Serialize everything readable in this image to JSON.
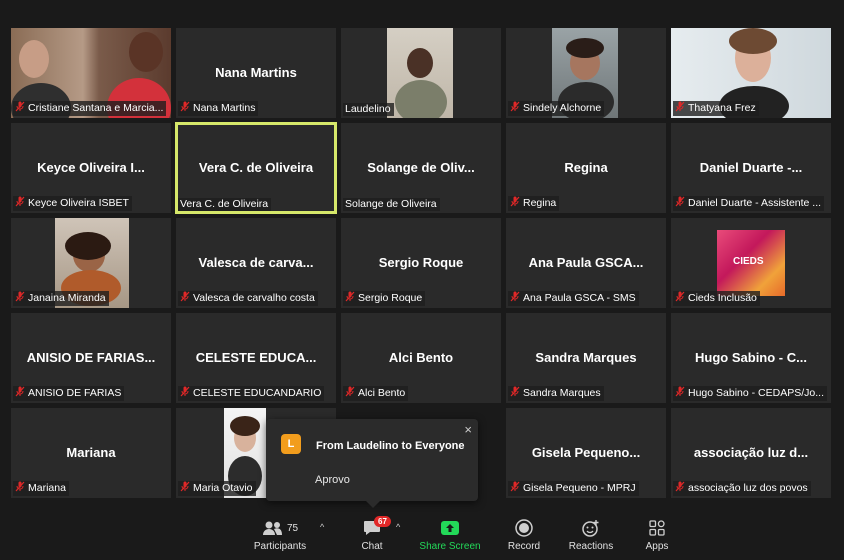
{
  "tiles": [
    {
      "name": "Cristiane Santana e Marcia...",
      "big": "",
      "video": "two",
      "muted": true
    },
    {
      "name": "Nana Martins",
      "big": "Nana Martins",
      "muted": true
    },
    {
      "name": "Laudelino",
      "big": "",
      "video": "man",
      "muted": false
    },
    {
      "name": "Sindely Alchorne",
      "big": "",
      "video": "woman1",
      "muted": true
    },
    {
      "name": "Thatyana Frez",
      "big": "",
      "video": "woman2",
      "muted": true
    },
    {
      "name": "Keyce Oliveira ISBET",
      "big": "Keyce Oliveira I...",
      "muted": true
    },
    {
      "name": "Vera C. de Oliveira",
      "big": "Vera C. de Oliveira",
      "muted": false,
      "active": true
    },
    {
      "name": "Solange de Oliveira",
      "big": "Solange de Oliv...",
      "muted": false
    },
    {
      "name": "Regina",
      "big": "Regina",
      "muted": true
    },
    {
      "name": "Daniel Duarte - Assistente ...",
      "big": "Daniel Duarte -...",
      "muted": true
    },
    {
      "name": "Janaina Miranda",
      "big": "",
      "video": "woman3",
      "muted": true
    },
    {
      "name": "Valesca de carvalho costa",
      "big": "Valesca de carva...",
      "muted": true
    },
    {
      "name": "Sergio Roque",
      "big": "Sergio Roque",
      "muted": true
    },
    {
      "name": "Ana Paula GSCA - SMS",
      "big": "Ana Paula GSCA...",
      "muted": true
    },
    {
      "name": "Cieds Inclusão",
      "big": "",
      "video": "logo",
      "logo_text": "CIEDS",
      "muted": true
    },
    {
      "name": "ANISIO DE FARIAS",
      "big": "ANISIO DE FARIAS...",
      "muted": true
    },
    {
      "name": "CELESTE EDUCANDARIO",
      "big": "CELESTE EDUCA...",
      "muted": true
    },
    {
      "name": "Alci Bento",
      "big": "Alci Bento",
      "muted": true
    },
    {
      "name": "Sandra Marques",
      "big": "Sandra Marques",
      "muted": true
    },
    {
      "name": "Hugo Sabino - CEDAPS/Jo...",
      "big": "Hugo Sabino - C...",
      "muted": true
    },
    {
      "name": "Mariana",
      "big": "Mariana",
      "muted": true
    },
    {
      "name": "Maria Otavio",
      "big": "",
      "video": "woman4",
      "muted": true
    },
    {
      "name": "",
      "big": "",
      "muted": false,
      "hidden": true
    },
    {
      "name": "Gisela Pequeno - MPRJ",
      "big": "Gisela Pequeno...",
      "muted": true
    },
    {
      "name": "associação luz dos povos",
      "big": "associação luz d...",
      "muted": true
    }
  ],
  "popup": {
    "avatar_letter": "L",
    "from": "From Laudelino to Everyone",
    "message": "Aprovo",
    "close": "×"
  },
  "toolbar": {
    "participants_label": "Participants",
    "participants_count": "75",
    "chat_label": "Chat",
    "chat_badge": "67",
    "share_label": "Share Screen",
    "record_label": "Record",
    "reactions_label": "Reactions",
    "apps_label": "Apps"
  },
  "colors": {
    "active_border": "#d6e86a",
    "share_green": "#23d959",
    "muted_red": "#e02828",
    "badge_red": "#e02828",
    "avatar_orange": "#f29d1d"
  }
}
